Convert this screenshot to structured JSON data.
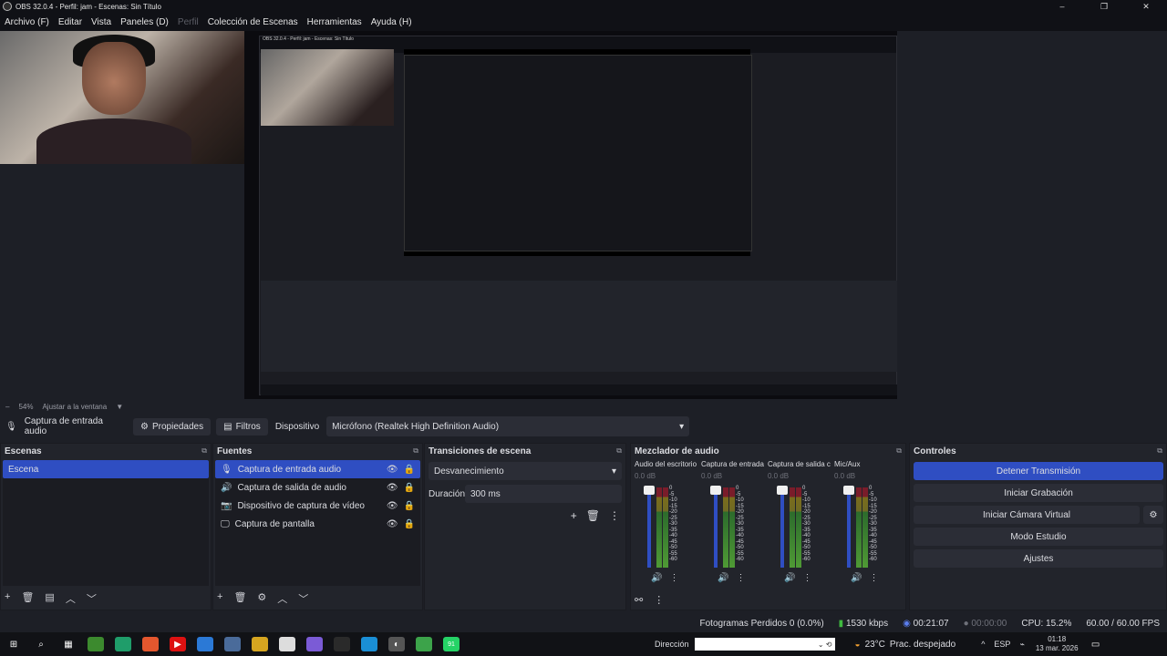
{
  "window": {
    "title": "OBS 32.0.4 - Perfil: jam - Escenas: Sin Título",
    "controls": [
      "–",
      "❐",
      "✕"
    ]
  },
  "menu": [
    {
      "label": "Archivo (F)",
      "disabled": false
    },
    {
      "label": "Editar",
      "disabled": false
    },
    {
      "label": "Vista",
      "disabled": false
    },
    {
      "label": "Paneles (D)",
      "disabled": false
    },
    {
      "label": "Perfil",
      "disabled": true
    },
    {
      "label": "Colección de Escenas",
      "disabled": false
    },
    {
      "label": "Herramientas",
      "disabled": false
    },
    {
      "label": "Ayuda (H)",
      "disabled": false
    }
  ],
  "zoom": {
    "value": "54%",
    "fit_label": "Ajustar a la ventana",
    "minus": "–"
  },
  "source_bar": {
    "source_name": "Captura de entrada audio",
    "properties": "Propiedades",
    "filters": "Filtros",
    "device_label": "Dispositivo",
    "device_value": "Micrófono (Realtek High Definition Audio)"
  },
  "scenes": {
    "title": "Escenas",
    "items": [
      "Escena"
    ]
  },
  "sources": {
    "title": "Fuentes",
    "items": [
      {
        "label": "Captura de entrada audio",
        "icon": "mic-icon"
      },
      {
        "label": "Captura de salida de audio",
        "icon": "speaker-icon"
      },
      {
        "label": "Dispositivo de captura de vídeo",
        "icon": "camera-icon"
      },
      {
        "label": "Captura de pantalla",
        "icon": "monitor-icon"
      }
    ]
  },
  "transitions": {
    "title": "Transiciones de escena",
    "selected": "Desvanecimiento",
    "duration_label": "Duración",
    "duration_value": "300 ms"
  },
  "mixer": {
    "title": "Mezclador de audio",
    "channels": [
      {
        "name": "Audio del escritorio",
        "db": "0.0 dB"
      },
      {
        "name": "Captura de entrada",
        "db": "0.0 dB"
      },
      {
        "name": "Captura de salida c",
        "db": "0.0 dB"
      },
      {
        "name": "Mic/Aux",
        "db": "0.0 dB"
      }
    ],
    "scale": [
      "0",
      "-5",
      "-10",
      "-15",
      "-20",
      "-25",
      "-30",
      "-35",
      "-40",
      "-45",
      "-50",
      "-55",
      "-60"
    ]
  },
  "controls": {
    "title": "Controles",
    "stop_stream": "Detener Transmisión",
    "start_recording": "Iniciar Grabación",
    "start_virtual_cam": "Iniciar Cámara Virtual",
    "studio_mode": "Modo Estudio",
    "settings": "Ajustes"
  },
  "status": {
    "dropped": "Fotogramas Perdidos 0 (0.0%)",
    "bitrate": "1530 kbps",
    "stream_time": "00:21:07",
    "rec_time": "00:00:00",
    "cpu": "CPU: 15.2%",
    "fps": "60.00 / 60.00 FPS"
  },
  "taskbar": {
    "search_label": "Dirección",
    "weather_temp": "23°C",
    "weather_desc": "Prac. despejado",
    "lang": "ESP",
    "time": "01:18",
    "date": "13 mar. 2026",
    "badge": "91"
  },
  "colors": {
    "accent": "#2f4ec2",
    "panel": "#22242b",
    "background": "#1d1f26"
  }
}
